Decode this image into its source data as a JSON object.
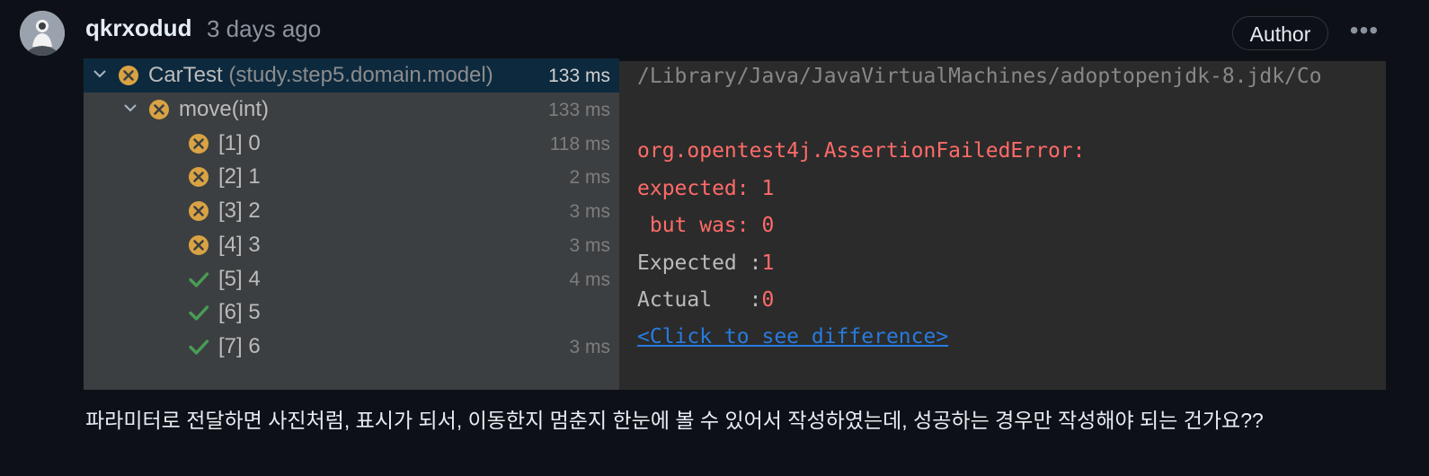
{
  "comment": {
    "username": "qkrxodud",
    "time": "3 days ago",
    "badge": "Author",
    "more_icon": "kebab-horizontal-icon",
    "body": "파라미터로 전달하면 사진처럼, 표시가 되서, 이동한지 멈춘지 한눈에 볼 수 있어서 작성하였는데, 성공하는 경우만 작성해야 되는 건가요??"
  },
  "test_tree": {
    "rows": [
      {
        "label": "CarTest",
        "sub": " (study.step5.domain.model)",
        "time": "133 ms",
        "status": "failed",
        "level": 0,
        "expanded": true,
        "selected": true
      },
      {
        "label": "move(int)",
        "sub": "",
        "time": "133 ms",
        "status": "failed",
        "level": 1,
        "expanded": true,
        "selected": false
      },
      {
        "label": "[1] 0",
        "sub": "",
        "time": "118 ms",
        "status": "failed",
        "level": 2,
        "selected": false
      },
      {
        "label": "[2] 1",
        "sub": "",
        "time": "2 ms",
        "status": "failed",
        "level": 2,
        "selected": false
      },
      {
        "label": "[3] 2",
        "sub": "",
        "time": "3 ms",
        "status": "failed",
        "level": 2,
        "selected": false
      },
      {
        "label": "[4] 3",
        "sub": "",
        "time": "3 ms",
        "status": "failed",
        "level": 2,
        "selected": false
      },
      {
        "label": "[5] 4",
        "sub": "",
        "time": "4 ms",
        "status": "passed",
        "level": 2,
        "selected": false
      },
      {
        "label": "[6] 5",
        "sub": "",
        "time": "",
        "status": "passed",
        "level": 2,
        "selected": false
      },
      {
        "label": "[7] 6",
        "sub": "",
        "time": "3 ms",
        "status": "passed",
        "level": 2,
        "selected": false
      }
    ]
  },
  "console": {
    "path": "/Library/Java/JavaVirtualMachines/adoptopenjdk-8.jdk/Co",
    "error_class": "org.opentest4j.AssertionFailedError:",
    "expected_line": "expected: 1",
    "but_was_line": " but was: 0",
    "expected_label": "Expected :",
    "expected_value": "1",
    "actual_label": "Actual   :",
    "actual_value": "0",
    "link": "<Click to see difference>"
  },
  "colors": {
    "failed": "#d9a343",
    "passed": "#499c54",
    "error_text": "#ff6b68",
    "link": "#287bde",
    "selected_row": "#0d293e"
  }
}
